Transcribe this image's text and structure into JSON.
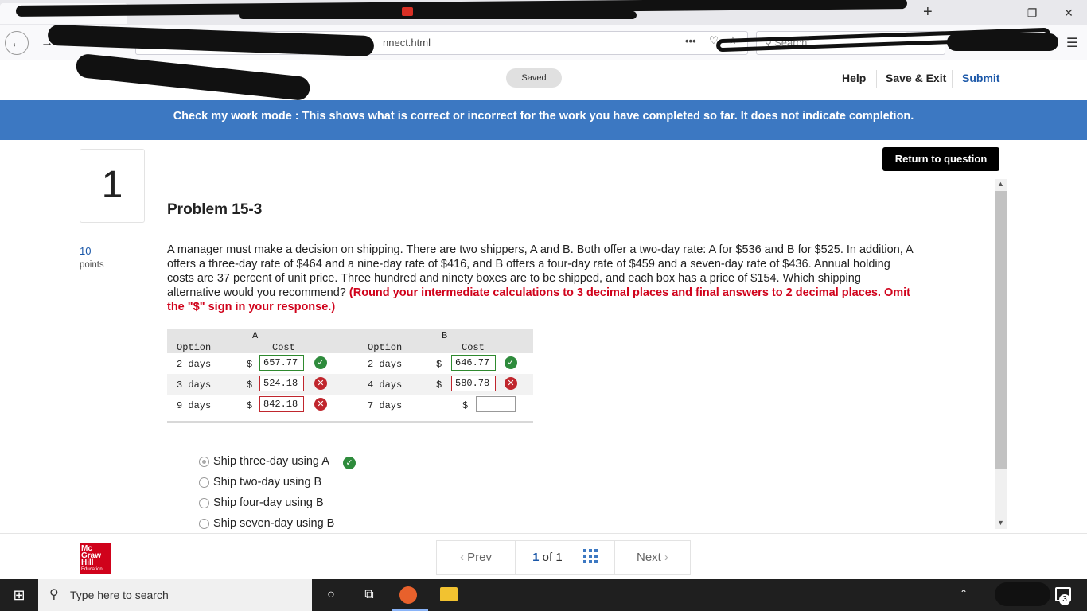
{
  "browser": {
    "url_fragment": "nnect.html",
    "search_placeholder": "Search",
    "more_label": "•••",
    "menu_icon": "☰",
    "plus_tab": "+",
    "win_min": "—",
    "win_max": "❐",
    "win_close": "✕"
  },
  "header": {
    "saved": "Saved",
    "help": "Help",
    "save_exit": "Save & Exit",
    "submit": "Submit"
  },
  "banner": "Check my work mode : This shows what is correct or incorrect for the work you have completed so far. It does not indicate completion.",
  "return_button": "Return to question",
  "question": {
    "number": "1",
    "points": "10",
    "points_label": "points",
    "title": "Problem 15-3",
    "text": "A manager must make a decision on shipping. There are two shippers, A and B. Both offer a two-day rate: A for $536 and B for $525. In addition, A offers a three-day rate of $464 and a nine-day rate of $416, and B offers a four-day rate of $459 and a seven-day rate of $436. Annual holding costs are 37 percent of unit price. Three hundred and ninety boxes are to be shipped, and each box has a price of $154. Which shipping alternative would you recommend? ",
    "instruction": "(Round your intermediate calculations to 3 decimal places and final answers to 2 decimal places. Omit the \"$\" sign in your response.)"
  },
  "table": {
    "group_a": "A",
    "group_b": "B",
    "col_option": "Option",
    "col_cost": "Cost",
    "currency": "$",
    "rows": [
      {
        "a_option": "2 days",
        "a_cost": "657.77",
        "b_option": "2 days",
        "b_cost": "646.77"
      },
      {
        "a_option": "3 days",
        "a_cost": "524.18",
        "b_option": "4 days",
        "b_cost": "580.78"
      },
      {
        "a_option": "9 days",
        "a_cost": "842.18",
        "b_option": "7 days",
        "b_cost": ""
      }
    ]
  },
  "options": [
    "Ship three-day using A",
    "Ship two-day using B",
    "Ship four-day using B",
    "Ship seven-day using B"
  ],
  "footer": {
    "logo_line1": "Mc",
    "logo_line2": "Graw",
    "logo_line3": "Hill",
    "logo_line4": "Education",
    "prev": "Prev",
    "page_current": "1",
    "page_of": "of",
    "page_total": "1",
    "next": "Next"
  },
  "taskbar": {
    "search_placeholder": "Type here to search",
    "notification_count": "3"
  }
}
